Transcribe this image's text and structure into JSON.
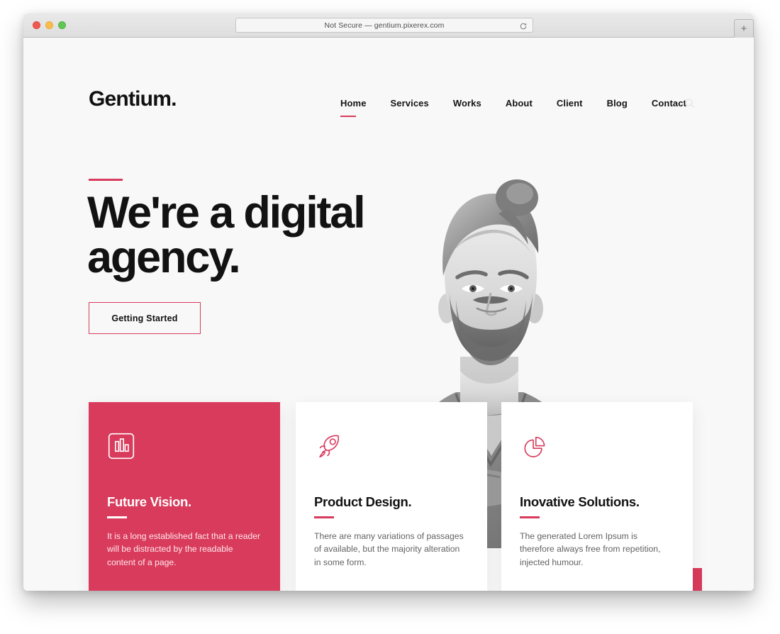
{
  "browser": {
    "url_text": "Not Secure — gentium.pixerex.com",
    "reload_icon": "reload-icon",
    "newtab_label": "+",
    "traffic_lights": [
      "close",
      "minimize",
      "zoom"
    ]
  },
  "site": {
    "logo": "Gentium.",
    "nav": [
      {
        "label": "Home",
        "active": true
      },
      {
        "label": "Services",
        "active": false
      },
      {
        "label": "Works",
        "active": false
      },
      {
        "label": "About",
        "active": false
      },
      {
        "label": "Client",
        "active": false
      },
      {
        "label": "Blog",
        "active": false
      },
      {
        "label": "Contact",
        "active": false
      }
    ],
    "search_icon": "search-icon"
  },
  "hero": {
    "title_line1": "We're a digital",
    "title_line2": "agency.",
    "cta_label": "Getting Started",
    "photo_alt": "bearded-man-portrait"
  },
  "cards": [
    {
      "icon": "bar-chart-icon",
      "title": "Future Vision.",
      "text": "It is a long established fact that a reader will be distracted by the readable content of a page."
    },
    {
      "icon": "rocket-icon",
      "title": "Product Design.",
      "text": "There are many variations of passages of available, but the majority alteration in some form."
    },
    {
      "icon": "pie-chart-icon",
      "title": "Inovative Solutions.",
      "text": "The generated Lorem Ipsum is therefore always free from repetition, injected humour."
    }
  ],
  "colors": {
    "accent": "#d93b5c",
    "page_bg": "#f8f8f8",
    "text_dark": "#121212",
    "text_body": "#636363"
  }
}
